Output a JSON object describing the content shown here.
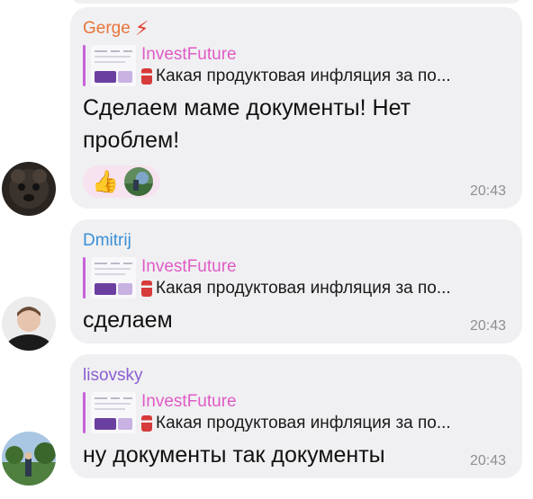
{
  "messages": [
    {
      "sender": "Gerge",
      "reply_title": "InvestFuture",
      "reply_quote": "Какая продуктовая инфляция за по...",
      "text": "Сделаем маме документы! Нет проблем!",
      "time": "20:43",
      "reactions": [
        "thumbs-up-icon",
        "user-avatar"
      ]
    },
    {
      "sender": "Dmitrij",
      "reply_title": "InvestFuture",
      "reply_quote": "Какая продуктовая инфляция за по...",
      "text": "сделаем",
      "time": "20:43"
    },
    {
      "sender": "lisovsky",
      "reply_title": "InvestFuture",
      "reply_quote": "Какая продуктовая инфляция за по...",
      "text": "ну документы так документы",
      "time": "20:43"
    }
  ],
  "colors": {
    "bubble": "#f0f0f2",
    "reply_bar": "#c761d9",
    "reply_title": "#e05bc6",
    "sender_gerge": "#e8743b",
    "sender_dmitrij": "#3a8fd6",
    "sender_lisovsky": "#8b5fd0",
    "time": "#8e8e93"
  }
}
